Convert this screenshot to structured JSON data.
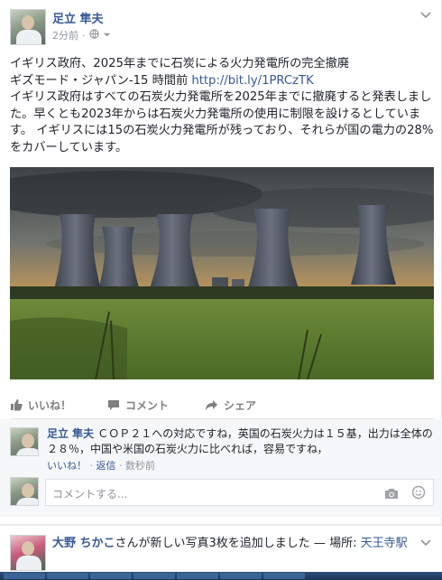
{
  "post": {
    "author": "足立 隼夫",
    "time": "2分前",
    "meta_sep": "·",
    "icons": [
      "globe-icon",
      "chevron-down-icon"
    ],
    "title_line": "イギリス政府、2025年までに石炭による火力発電所の完全撤廃",
    "source_line": "ギズモード・ジャパン-15 時間前 ",
    "link": "http://bit.ly/1PRCzTK",
    "body": "イギリス政府はすべての石炭火力発電所を2025年までに撤廃すると発表しました。早くとも2023年からは石炭火力発電所の使用に制限を設けるとしています。 イギリスには15の石炭火力発電所が残っており、それらが国の電力の28%をカバーしています。"
  },
  "actions": {
    "like": "いいね！",
    "comment": "コメント",
    "share": "シェア"
  },
  "comment": {
    "author": "足立 隼夫",
    "text": "ＣＯＰ２１への対応ですね，英国の石炭火力は１５基，出力は全体の２８％，中国や米国の石炭火力に比べれば，容易ですね，",
    "like": "いいね！",
    "sep": " · ",
    "reply": "返信",
    "time": "数秒前"
  },
  "comment_input": {
    "placeholder": "コメントする...",
    "icons": [
      "camera-icon",
      "emoji-icon"
    ]
  },
  "next_post": {
    "author": "大野 ちかこ",
    "action": "さんが新しい写真3枚を追加しました — 場所: ",
    "place": "天王寺駅"
  },
  "colors": {
    "link_blue": "#365899",
    "meta_gray": "#90949c",
    "background": "#e9ebee"
  }
}
